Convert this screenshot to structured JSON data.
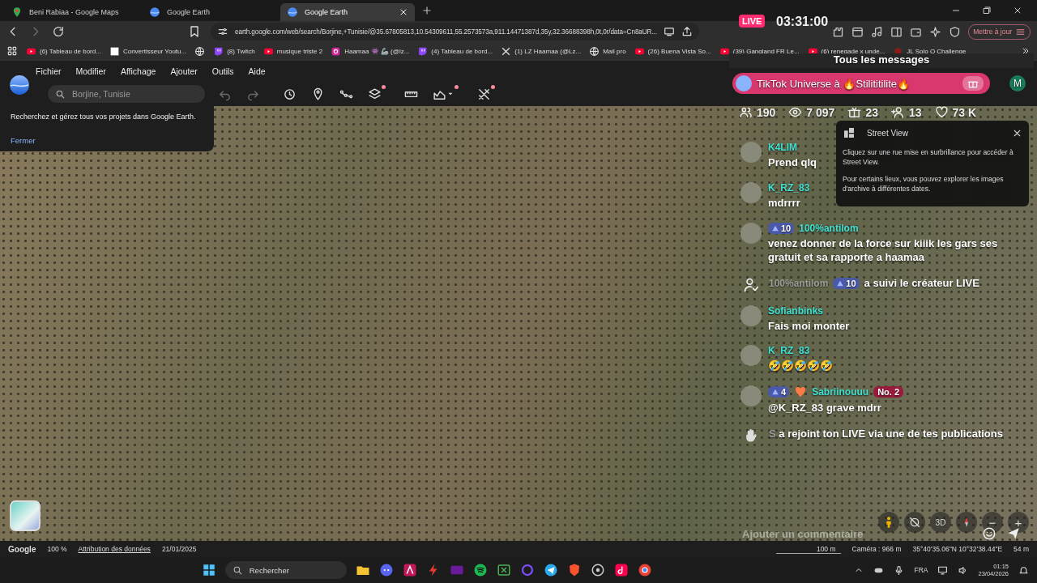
{
  "browser": {
    "tabs": [
      {
        "title": "Beni Rabiaa - Google Maps",
        "kind": "maps",
        "selected": false
      },
      {
        "title": "Google Earth",
        "kind": "earth",
        "selected": false
      },
      {
        "title": "Google Earth",
        "kind": "earth",
        "selected": true
      }
    ],
    "url": "earth.google.com/web/search/Borjine,+Tunisie/@35.67805813,10.54309611,55.2573573a,911.14471387d,35y,32.36688398h,0t,0r/data=Cn8aUR...",
    "update_button": "Mettre à jour",
    "bookmarks": [
      {
        "title": "(6) Tableau de bord...",
        "kind": "youtube"
      },
      {
        "title": "Convertisseur Youtu...",
        "kind": "page"
      },
      {
        "kind": "globe"
      },
      {
        "title": "(8) Twitch",
        "kind": "twitch"
      },
      {
        "title": "musique triste 2",
        "kind": "youtube"
      },
      {
        "title": "Haamaa 👾 🦾 (@lz...",
        "kind": "instagram"
      },
      {
        "title": "(4) Tableau de bord...",
        "kind": "twitch"
      },
      {
        "title": "(1) LZ Haamaa (@Lz...",
        "kind": "x"
      },
      {
        "title": "Mail pro",
        "kind": "globe"
      },
      {
        "title": "(26) Buena Vista So...",
        "kind": "youtube"
      },
      {
        "title": "(39) Gangland FR Le...",
        "kind": "youtube"
      },
      {
        "title": "(6) renegade x unde...",
        "kind": "youtube"
      },
      {
        "title": "JL Solo Q Challenge",
        "kind": "dot"
      }
    ]
  },
  "earth": {
    "menu": [
      "Fichier",
      "Modifier",
      "Affichage",
      "Ajouter",
      "Outils",
      "Aide"
    ],
    "search": {
      "placeholder": "Borjine, Tunisie"
    },
    "tools": [
      {
        "kind": "undo",
        "badge": false
      },
      {
        "kind": "redo",
        "badge": false
      },
      {
        "kind": "history",
        "badge": false
      },
      {
        "kind": "pin",
        "badge": false
      },
      {
        "kind": "path",
        "badge": false
      },
      {
        "kind": "layers",
        "badge": true
      },
      {
        "kind": "ruler",
        "badge": false
      },
      {
        "kind": "chart",
        "badge": true
      },
      {
        "kind": "tools",
        "badge": true
      }
    ],
    "projects_tip": {
      "text": "Recherchez et gérez tous vos projets dans Google Earth.",
      "link": "Fermer"
    },
    "street_view": {
      "title": "Street View",
      "paragraphs": [
        "Cliquez sur une rue mise en surbrillance pour accéder à Street View.",
        "Pour certains lieux, vous pouvez explorer les images d'archive à différentes dates."
      ]
    },
    "controls": [
      {
        "kind": "pegman"
      },
      {
        "kind": "compass-off"
      },
      {
        "kind": "text",
        "label": "3D"
      },
      {
        "kind": "compass"
      },
      {
        "kind": "zoom-out",
        "label": "−"
      },
      {
        "kind": "zoom-in",
        "label": "+"
      }
    ],
    "status": {
      "brand": "Google",
      "zoom": "100 %",
      "attribution": "Attribution des données",
      "date": "21/01/2025",
      "scale": "100 m",
      "camera": "Caméra : 966 m",
      "coords": "35°40'35.06\"N 10°32'38.44\"E",
      "altitude": "54 m"
    }
  },
  "live": {
    "badge": "LIVE",
    "timer": "03:31:00",
    "header": "Tous les messages",
    "banner": "TikTok Universe à 🔥Stilititilite🔥",
    "avatar_letter": "M",
    "stats": [
      {
        "kind": "viewers",
        "value": "190"
      },
      {
        "kind": "views",
        "value": "7 097"
      },
      {
        "kind": "gifts",
        "value": "23"
      },
      {
        "kind": "follows",
        "value": "13"
      },
      {
        "kind": "likes",
        "value": "73 K"
      }
    ],
    "messages": [
      {
        "kind": "comment",
        "user": "K4LIM",
        "text": "Prend qlq"
      },
      {
        "kind": "comment",
        "user": "K_RZ_83",
        "text": "mdrrrr"
      },
      {
        "kind": "comment",
        "user": "100%antilom",
        "badges": [
          {
            "kind": "level",
            "text": "10"
          }
        ],
        "text": "venez donner de la force sur kiiik les gars ses gratuit et sa rapporte a haamaa"
      },
      {
        "kind": "follow",
        "user": "100%antilom",
        "badges": [
          {
            "kind": "level",
            "text": "10"
          }
        ],
        "text": "a suivi le créateur LIVE"
      },
      {
        "kind": "comment",
        "user": "Sofianbinks",
        "text": "Fais moi monter"
      },
      {
        "kind": "comment",
        "user": "K_RZ_83",
        "text": "🤣🤣🤣🤣🤣"
      },
      {
        "kind": "comment",
        "user": "Sabriinouuu",
        "badges": [
          {
            "kind": "level",
            "text": "4"
          },
          {
            "kind": "fan"
          },
          {
            "kind": "rank",
            "text": "No. 2"
          }
        ],
        "text": "@K_RZ_83 grave mdrr"
      },
      {
        "kind": "join",
        "user": "S",
        "text": "a rejoint ton LIVE via une de tes publications"
      }
    ],
    "comment": {
      "placeholder": "Ajouter un commentaire"
    }
  },
  "taskbar": {
    "search": {
      "placeholder": "Rechercher"
    },
    "language": "FRA",
    "time": "01:15",
    "date": "23/04/2026"
  }
}
